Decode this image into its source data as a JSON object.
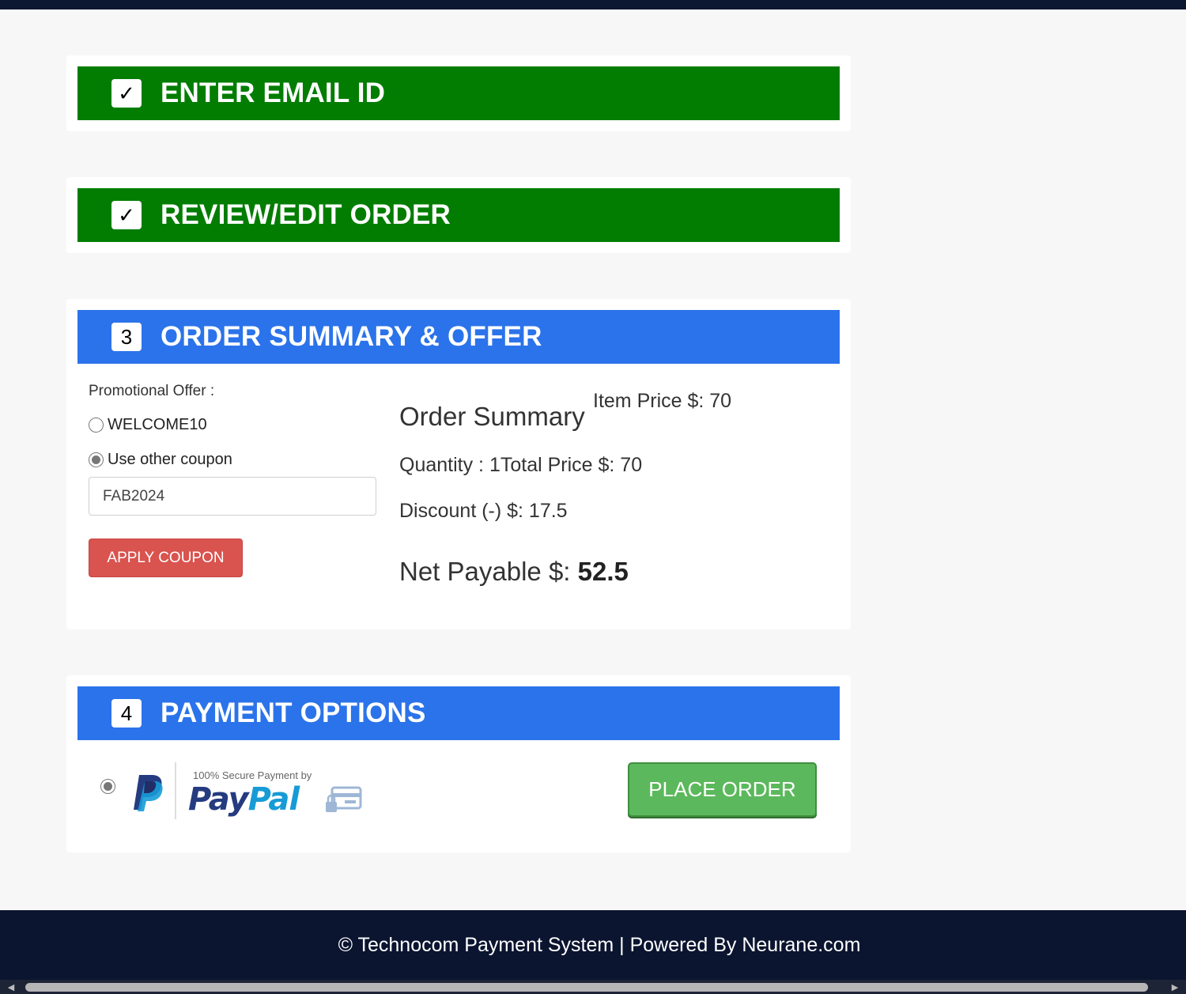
{
  "steps": [
    {
      "marker": "✓",
      "title": "ENTER EMAIL ID"
    },
    {
      "marker": "✓",
      "title": "REVIEW/EDIT ORDER"
    },
    {
      "marker": "3",
      "title": "ORDER SUMMARY & OFFER"
    },
    {
      "marker": "4",
      "title": "PAYMENT OPTIONS"
    }
  ],
  "promo": {
    "label": "Promotional Offer :",
    "options": [
      {
        "label": "WELCOME10",
        "checked": false
      },
      {
        "label": "Use other coupon",
        "checked": true
      }
    ],
    "coupon_value": "FAB2024",
    "apply_label": "APPLY COUPON"
  },
  "summary": {
    "title": "Order Summary",
    "item_price": "Item Price $: 70",
    "quantity_total": "Quantity : 1Total Price $: 70",
    "discount": "Discount (-) $: 17.5",
    "net_label": "Net Payable $: ",
    "net_value": "52.5"
  },
  "payment": {
    "secure_text": "100% Secure Payment by",
    "brand_pay": "Pay",
    "brand_pal": "Pal",
    "method_selected": true,
    "place_order_label": "PLACE ORDER"
  },
  "footer": {
    "text": "© Technocom Payment System | Powered By Neurane.com"
  },
  "colors": {
    "done_header": "#027d02",
    "active_header": "#2b73ea",
    "apply_button": "#d9534f",
    "place_order_button": "#5cb85c",
    "footer_bg": "#0b1530"
  },
  "icons": [
    "check-icon",
    "paypal-logo-icon",
    "secure-card-icon",
    "scroll-left-icon",
    "scroll-right-icon"
  ]
}
